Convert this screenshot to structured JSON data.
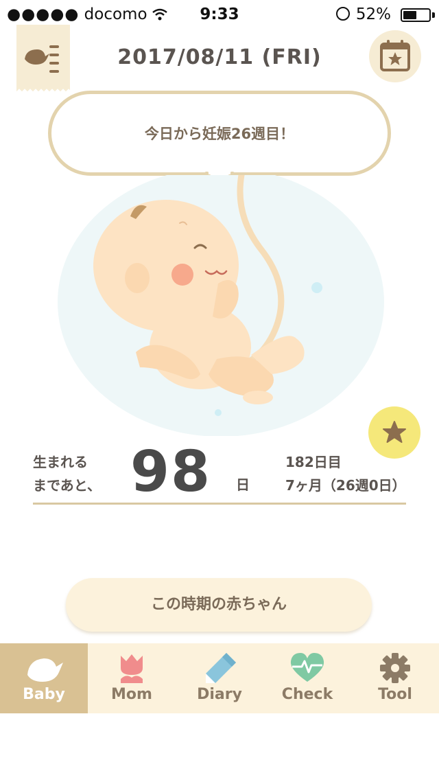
{
  "status_bar": {
    "signal": "●●●●●",
    "carrier": "docomo",
    "time": "9:33",
    "battery": "52%",
    "battery_level": 0.52
  },
  "header": {
    "date": "2017/08/11 (FRI)",
    "menu_icon": "bird-list-icon",
    "calendar_icon": "calendar-star-icon"
  },
  "bubble": {
    "text": "今日から妊娠26週目！"
  },
  "countdown": {
    "label_line1": "生まれる",
    "label_line2": "まであと、",
    "days": "98",
    "unit": "日",
    "info_line1": "182日目",
    "info_line2": "7ヶ月（26週0日）"
  },
  "period_button": {
    "label": "この時期の赤ちゃん"
  },
  "tabs": [
    {
      "label": "Baby",
      "icon": "bird-icon",
      "active": true
    },
    {
      "label": "Mom",
      "icon": "tulip-icon",
      "active": false
    },
    {
      "label": "Diary",
      "icon": "pencil-icon",
      "active": false
    },
    {
      "label": "Check",
      "icon": "heart-pulse-icon",
      "active": false
    },
    {
      "label": "Tool",
      "icon": "gear-icon",
      "active": false
    }
  ],
  "colors": {
    "accent": "#d9c193",
    "cream": "#fcf2dc",
    "star_yellow": "#f5e87a",
    "bubble_border": "#e3d3ad",
    "mom_pink": "#f08c8c",
    "diary_blue": "#8ac5dc",
    "check_green": "#7fc9a3",
    "tool_brown": "#8c7b66"
  }
}
